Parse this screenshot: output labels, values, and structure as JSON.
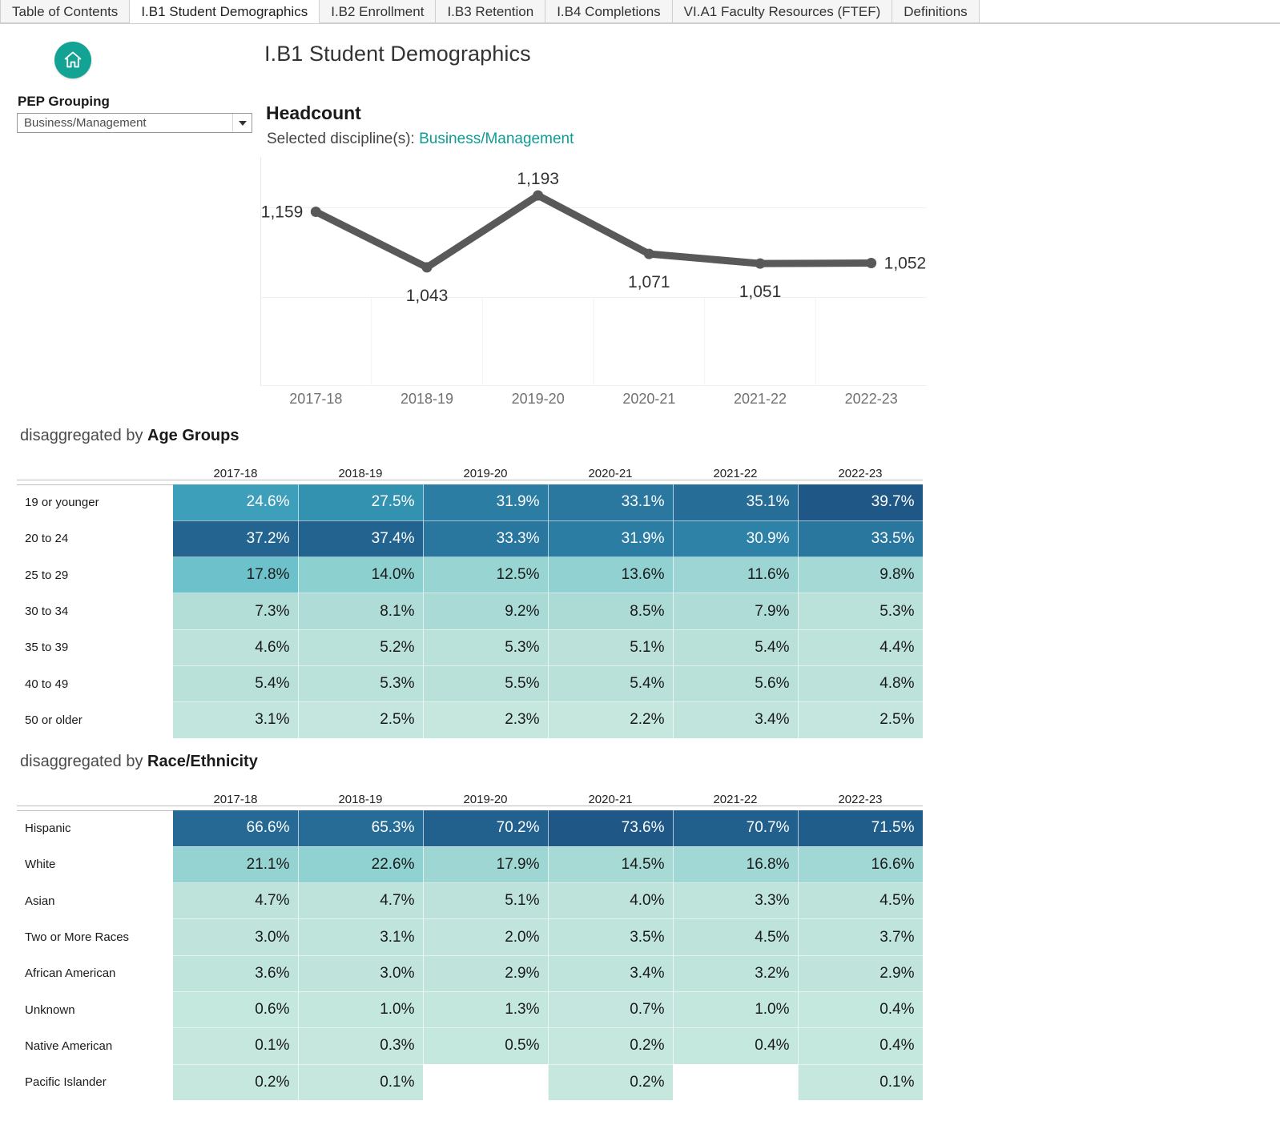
{
  "tabs": [
    {
      "label": "Table of Contents"
    },
    {
      "label": "I.B1 Student Demographics"
    },
    {
      "label": "I.B2 Enrollment"
    },
    {
      "label": "I.B3 Retention"
    },
    {
      "label": "I.B4 Completions"
    },
    {
      "label": "VI.A1 Faculty Resources (FTEF)"
    },
    {
      "label": "Definitions"
    }
  ],
  "header": {
    "title": "I.B1 Student Demographics"
  },
  "filter": {
    "label": "PEP Grouping",
    "value": "Business/Management",
    "icon": "chevron-down-icon"
  },
  "home": {
    "icon": "home-icon",
    "color": "#13a394"
  },
  "sections": {
    "age": {
      "prefix": "disaggregated by ",
      "name": "Age Groups"
    },
    "race": {
      "prefix": "disaggregated by ",
      "name": "Race/Ethnicity"
    }
  },
  "chart_data": {
    "type": "line",
    "title": "Headcount",
    "subtitle_prefix": "Selected discipline(s): ",
    "subtitle_value": "Business/Management",
    "xlabel": "",
    "ylabel": "",
    "categories": [
      "2017-18",
      "2018-19",
      "2019-20",
      "2020-21",
      "2021-22",
      "2022-23"
    ],
    "values": [
      1159,
      1043,
      1193,
      1071,
      1051,
      1052
    ],
    "labels": [
      "1,159",
      "1,043",
      "1,193",
      "1,071",
      "1,051",
      "1,052"
    ],
    "label_positions": [
      "left",
      "below",
      "above",
      "below",
      "below",
      "right"
    ],
    "ylim": [
      980,
      1230
    ],
    "grid": true,
    "legend": "none",
    "line_color": "#595959",
    "accent_color": "#0f9c94"
  },
  "heatmaps": [
    {
      "id": "age",
      "columns": [
        "2017-18",
        "2018-19",
        "2019-20",
        "2020-21",
        "2021-22",
        "2022-23"
      ],
      "rows": [
        {
          "label": "19 or younger",
          "values": [
            "24.6%",
            "27.5%",
            "31.9%",
            "33.1%",
            "35.1%",
            "39.7%"
          ],
          "nums": [
            24.6,
            27.5,
            31.9,
            33.1,
            35.1,
            39.7
          ]
        },
        {
          "label": "20 to 24",
          "values": [
            "37.2%",
            "37.4%",
            "33.3%",
            "31.9%",
            "30.9%",
            "33.5%"
          ],
          "nums": [
            37.2,
            37.4,
            33.3,
            31.9,
            30.9,
            33.5
          ]
        },
        {
          "label": "25 to 29",
          "values": [
            "17.8%",
            "14.0%",
            "12.5%",
            "13.6%",
            "11.6%",
            "9.8%"
          ],
          "nums": [
            17.8,
            14.0,
            12.5,
            13.6,
            11.6,
            9.8
          ]
        },
        {
          "label": "30 to 34",
          "values": [
            "7.3%",
            "8.1%",
            "9.2%",
            "8.5%",
            "7.9%",
            "5.3%"
          ],
          "nums": [
            7.3,
            8.1,
            9.2,
            8.5,
            7.9,
            5.3
          ]
        },
        {
          "label": "35 to 39",
          "values": [
            "4.6%",
            "5.2%",
            "5.3%",
            "5.1%",
            "5.4%",
            "4.4%"
          ],
          "nums": [
            4.6,
            5.2,
            5.3,
            5.1,
            5.4,
            4.4
          ]
        },
        {
          "label": "40 to 49",
          "values": [
            "5.4%",
            "5.3%",
            "5.5%",
            "5.4%",
            "5.6%",
            "4.8%"
          ],
          "nums": [
            5.4,
            5.3,
            5.5,
            5.4,
            5.6,
            4.8
          ]
        },
        {
          "label": "50 or older",
          "values": [
            "3.1%",
            "2.5%",
            "2.3%",
            "2.2%",
            "3.4%",
            "2.5%"
          ],
          "nums": [
            3.1,
            2.5,
            2.3,
            2.2,
            3.4,
            2.5
          ]
        }
      ]
    },
    {
      "id": "race",
      "columns": [
        "2017-18",
        "2018-19",
        "2019-20",
        "2020-21",
        "2021-22",
        "2022-23"
      ],
      "rows": [
        {
          "label": "Hispanic",
          "values": [
            "66.6%",
            "65.3%",
            "70.2%",
            "73.6%",
            "70.7%",
            "71.5%"
          ],
          "nums": [
            66.6,
            65.3,
            70.2,
            73.6,
            70.7,
            71.5
          ]
        },
        {
          "label": "White",
          "values": [
            "21.1%",
            "22.6%",
            "17.9%",
            "14.5%",
            "16.8%",
            "16.6%"
          ],
          "nums": [
            21.1,
            22.6,
            17.9,
            14.5,
            16.8,
            16.6
          ]
        },
        {
          "label": "Asian",
          "values": [
            "4.7%",
            "4.7%",
            "5.1%",
            "4.0%",
            "3.3%",
            "4.5%"
          ],
          "nums": [
            4.7,
            4.7,
            5.1,
            4.0,
            3.3,
            4.5
          ]
        },
        {
          "label": "Two or More Races",
          "values": [
            "3.0%",
            "3.1%",
            "2.0%",
            "3.5%",
            "4.5%",
            "3.7%"
          ],
          "nums": [
            3.0,
            3.1,
            2.0,
            3.5,
            4.5,
            3.7
          ]
        },
        {
          "label": "African American",
          "values": [
            "3.6%",
            "3.0%",
            "2.9%",
            "3.4%",
            "3.2%",
            "2.9%"
          ],
          "nums": [
            3.6,
            3.0,
            2.9,
            3.4,
            3.2,
            2.9
          ]
        },
        {
          "label": "Unknown",
          "values": [
            "0.6%",
            "1.0%",
            "1.3%",
            "0.7%",
            "1.0%",
            "0.4%"
          ],
          "nums": [
            0.6,
            1.0,
            1.3,
            0.7,
            1.0,
            0.4
          ]
        },
        {
          "label": "Native American",
          "values": [
            "0.1%",
            "0.3%",
            "0.5%",
            "0.2%",
            "0.4%",
            "0.4%"
          ],
          "nums": [
            0.1,
            0.3,
            0.5,
            0.2,
            0.4,
            0.4
          ]
        },
        {
          "label": "Pacific Islander",
          "values": [
            "0.2%",
            "0.1%",
            "",
            "0.2%",
            "",
            "0.1%"
          ],
          "nums": [
            0.2,
            0.1,
            null,
            0.2,
            null,
            0.1
          ]
        }
      ]
    }
  ]
}
